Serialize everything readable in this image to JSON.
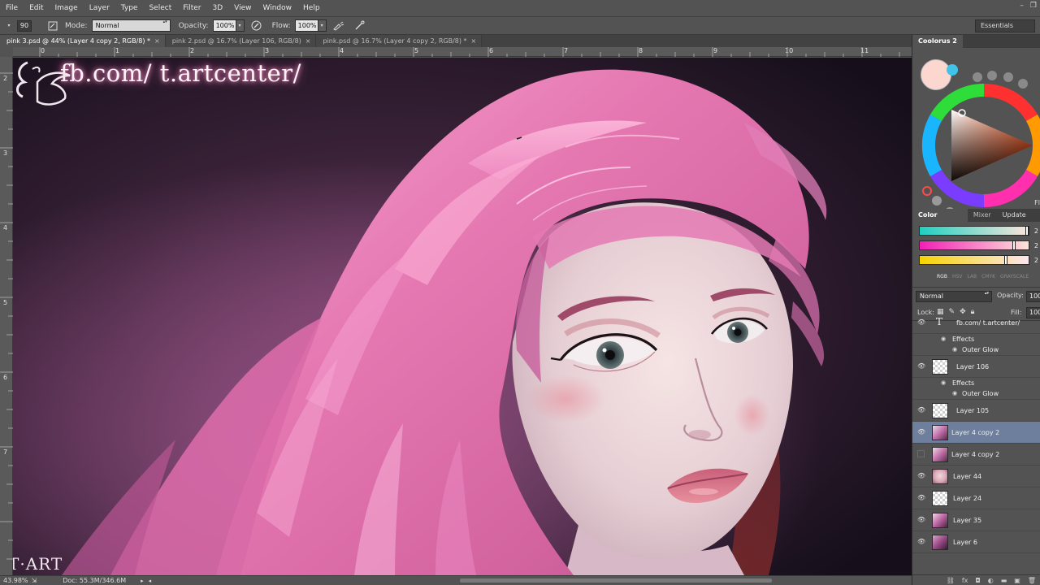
{
  "menu": [
    "File",
    "Edit",
    "Image",
    "Layer",
    "Type",
    "Select",
    "Filter",
    "3D",
    "View",
    "Window",
    "Help"
  ],
  "window_controls": [
    "–",
    "❐"
  ],
  "options": {
    "brush_size": "90",
    "mode_label": "Mode:",
    "mode_value": "Normal",
    "opacity_label": "Opacity:",
    "opacity_value": "100%",
    "flow_label": "Flow:",
    "flow_value": "100%",
    "workspace": "Essentials"
  },
  "tabs": [
    {
      "label": "pink 3.psd @ 44% (Layer 4 copy 2, RGB/8) *",
      "active": true
    },
    {
      "label": "pink 2.psd @ 16.7% (Layer 106, RGB/8)",
      "active": false
    },
    {
      "label": "pink.psd @ 16.7% (Layer 4 copy 2, RGB/8) *",
      "active": false
    }
  ],
  "ruler_top": [
    "0",
    "1",
    "2",
    "3",
    "4",
    "5",
    "6",
    "7",
    "8",
    "9",
    "10",
    "11"
  ],
  "ruler_left": [
    "2",
    "3",
    "4",
    "5",
    "6",
    "7"
  ],
  "canvas": {
    "watermark": "fb.com/ t.artcenter/",
    "logo_text": "T·ART"
  },
  "status": {
    "zoom": "43.98%",
    "doc": "Doc: 55.3M/346.6M"
  },
  "coolorus": {
    "tab": "Coolorus 2",
    "current_color": "#fcd7cf",
    "fl_label": "Fl"
  },
  "color_sliders": {
    "tabs": [
      "Color Sliders",
      "Mixer",
      "Update Co"
    ],
    "values": [
      "2",
      "2",
      "2"
    ],
    "modes": [
      "RGB",
      "HSV",
      "LAB",
      "CMYK",
      "GRAYSCALE"
    ]
  },
  "layers_panel": {
    "blend_mode": "Normal",
    "opacity_label": "Opacity:",
    "opacity_value": "100",
    "lock_label": "Lock:",
    "fill_label": "Fill:",
    "fill_value": "100",
    "rows": [
      {
        "kind": "text",
        "name": "fb.com/ t.artcenter/",
        "visible": true
      },
      {
        "kind": "effects",
        "name": "Effects"
      },
      {
        "kind": "effect",
        "name": "Outer Glow"
      },
      {
        "kind": "layer",
        "name": "Layer 106",
        "visible": true,
        "thumb": "checker"
      },
      {
        "kind": "effects",
        "name": "Effects"
      },
      {
        "kind": "effect",
        "name": "Outer Glow"
      },
      {
        "kind": "layer",
        "name": "Layer 105",
        "visible": true,
        "thumb": "checker"
      },
      {
        "kind": "layer",
        "name": "Layer 4 copy 2",
        "visible": true,
        "thumb": "portrait",
        "selected": true
      },
      {
        "kind": "layer",
        "name": "Layer 4 copy 2",
        "visible": false,
        "thumb": "portrait"
      },
      {
        "kind": "layer",
        "name": "Layer 44",
        "visible": true,
        "thumb": "face"
      },
      {
        "kind": "layer",
        "name": "Layer 24",
        "visible": true,
        "thumb": "checker"
      },
      {
        "kind": "layer",
        "name": "Layer 35",
        "visible": true,
        "thumb": "portrait"
      },
      {
        "kind": "layer",
        "name": "Layer 6",
        "visible": true,
        "thumb": "portrait2"
      }
    ]
  }
}
